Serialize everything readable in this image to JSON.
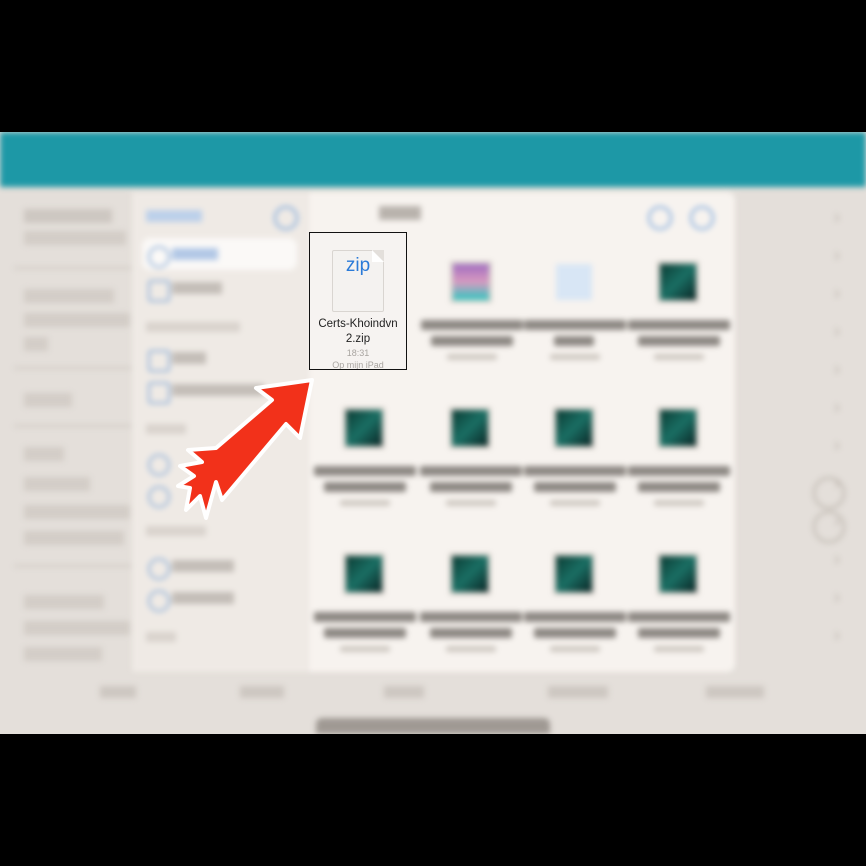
{
  "highlighted_file": {
    "icon_label": "zip",
    "name_line1": "Certs-Khoindvn",
    "name_line2": "2.zip",
    "time": "18:31",
    "location": "Op mijn iPad"
  },
  "colors": {
    "accent": "#1d98a6",
    "arrow": "#f2311a",
    "zip_blue": "#2b7bd8"
  },
  "icons": {
    "pointer": "red-arrow-icon",
    "file": "zip-file-icon"
  }
}
